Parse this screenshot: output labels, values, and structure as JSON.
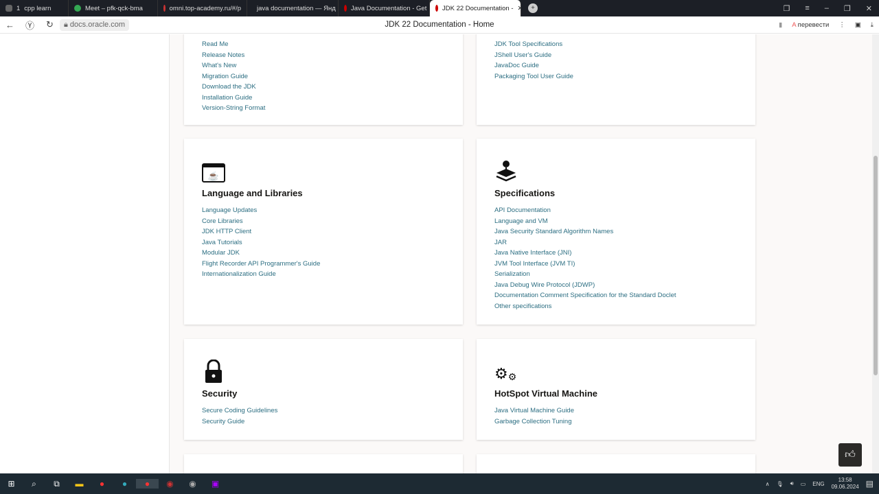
{
  "browser": {
    "tabs": [
      {
        "label": "cpp learn",
        "badge": "1",
        "color": "#555"
      },
      {
        "label": "Meet – pfk-qck-bma",
        "color": "#34a853"
      },
      {
        "label": "omni.top-academy.ru/#/p",
        "color": "#c33"
      },
      {
        "label": "java documentation — Янд",
        "color": "#e22"
      },
      {
        "label": "Java Documentation - Get",
        "color": "#c00"
      },
      {
        "label": "JDK 22 Documentation -",
        "color": "#c00",
        "active": true
      }
    ],
    "url": "docs.oracle.com",
    "page_title": "JDK 22 Documentation - Home",
    "translate_label": "перевести"
  },
  "cards": [
    {
      "title": "",
      "links": [
        "Read Me",
        "Release Notes",
        "What's New",
        "Migration Guide",
        "Download the JDK",
        "Installation Guide",
        "Version-String Format"
      ]
    },
    {
      "title": "",
      "links": [
        "JDK Tool Specifications",
        "JShell User's Guide",
        "JavaDoc Guide",
        "Packaging Tool User Guide"
      ]
    },
    {
      "title": "Language and Libraries",
      "icon": "java-window-icon",
      "links": [
        "Language Updates",
        "Core Libraries",
        "JDK HTTP Client",
        "Java Tutorials",
        "Modular JDK",
        "Flight Recorder API Programmer's Guide",
        "Internationalization Guide"
      ]
    },
    {
      "title": "Specifications",
      "icon": "layers-pin-icon",
      "links": [
        "API Documentation",
        "Language and VM",
        "Java Security Standard Algorithm Names",
        "JAR",
        "Java Native Interface (JNI)",
        "JVM Tool Interface (JVM TI)",
        "Serialization",
        "Java Debug Wire Protocol (JDWP)",
        "Documentation Comment Specification for the Standard Doclet",
        "Other specifications"
      ]
    },
    {
      "title": "Security",
      "icon": "lock-icon",
      "links": [
        "Secure Coding Guidelines",
        "Security Guide"
      ]
    },
    {
      "title": "HotSpot Virtual Machine",
      "icon": "gears-icon",
      "links": [
        "Java Virtual Machine Guide",
        "Garbage Collection Tuning"
      ]
    }
  ],
  "taskbar": {
    "lang": "ENG",
    "time": "13:58",
    "date": "09.06.2024"
  }
}
